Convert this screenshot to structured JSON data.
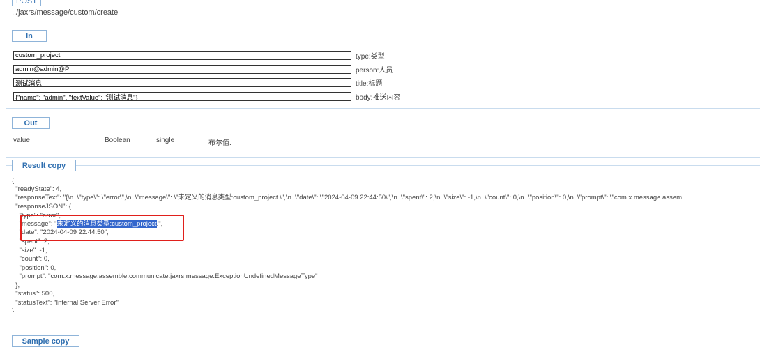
{
  "endpoint": {
    "method": "POST",
    "path": "../jaxrs/message/custom/create"
  },
  "in_section": {
    "legend": "In",
    "params": [
      {
        "value": "custom_project",
        "label": "type:类型"
      },
      {
        "value": "admin@admin@P",
        "label": "person:人员"
      },
      {
        "value": "测试消息",
        "label": "title:标题"
      },
      {
        "value": "{\"name\": \"admin\", \"textValue\": \"测试消息\"}",
        "label": "body:推送内容"
      }
    ]
  },
  "out_section": {
    "legend": "Out",
    "row": {
      "name": "value",
      "type": "Boolean",
      "mode": "single",
      "desc": "布尔值."
    }
  },
  "result_section": {
    "legend": "Result copy",
    "lines": [
      "{",
      "  \"readyState\": 4,",
      "  \"responseText\": \"{\\n  \\\"type\\\": \\\"error\\\",\\n  \\\"message\\\": \\\"未定义的消息类型:custom_project.\\\",\\n  \\\"date\\\": \\\"2024-04-09 22:44:50\\\",\\n  \\\"spent\\\": 2,\\n  \\\"size\\\": -1,\\n  \\\"count\\\": 0,\\n  \\\"position\\\": 0,\\n  \\\"prompt\\\": \\\"com.x.message.assem",
      "  \"responseJSON\": {",
      "    \"type\": \"error\",",
      "    \"message\": \"",
      "    \"date\": \"2024-04-09 22:44:50\",",
      "    \"spent\": 2,",
      "    \"size\": -1,",
      "    \"count\": 0,",
      "    \"position\": 0,",
      "    \"prompt\": \"com.x.message.assemble.communicate.jaxrs.message.ExceptionUndefinedMessageType\"",
      "  },",
      "  \"status\": 500,",
      "  \"statusText\": \"Internal Server Error\"",
      "}"
    ],
    "message_highlight": "未定义的消息类型:custom_project",
    "message_tail": ".\","
  },
  "sample_section": {
    "legend": "Sample copy"
  }
}
